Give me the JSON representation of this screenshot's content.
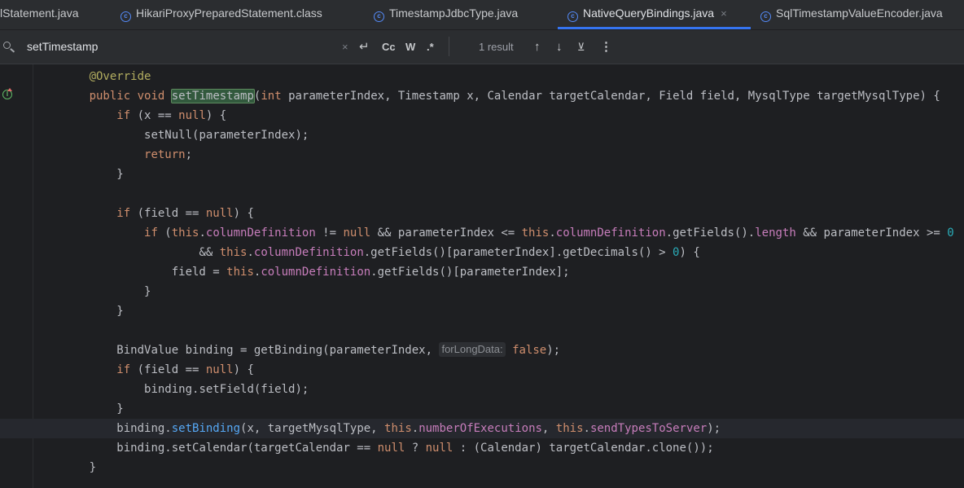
{
  "tabs": [
    {
      "label": "lStatement.java",
      "icon": "none",
      "active": false
    },
    {
      "label": "HikariProxyPreparedStatement.class",
      "icon": "class-icon",
      "active": false
    },
    {
      "label": "TimestampJdbcType.java",
      "icon": "class-icon",
      "active": false
    },
    {
      "label": "NativeQueryBindings.java",
      "icon": "class-icon",
      "active": true,
      "close": "×"
    },
    {
      "label": "SqlTimestampValueEncoder.java",
      "icon": "class-icon",
      "active": false
    }
  ],
  "search": {
    "query": "setTimestamp",
    "clear": "×",
    "newline": "↵",
    "match_case": "Cc",
    "words": "W",
    "regex": ".*",
    "result_count": "1 result",
    "prev": "↑",
    "next": "↓",
    "filter": "⊻",
    "more": "⋮"
  },
  "colors": {
    "background": "#1e1f22",
    "keyword": "#cf8e6d",
    "annotation": "#b3ae60",
    "field": "#c77dbb",
    "number": "#2aacb8",
    "active_tab_underline": "#3574f0",
    "search_highlight": "#32593d"
  },
  "code": {
    "inlay_hint": "forLongData:",
    "lines": [
      {
        "indent": "    ",
        "tokens": [
          [
            "ann",
            "@Override"
          ]
        ]
      },
      {
        "indent": "    ",
        "tokens": [
          [
            "kw",
            "public"
          ],
          [
            "",
            " "
          ],
          [
            "kw",
            "void"
          ],
          [
            "",
            " "
          ],
          [
            "hl",
            "setTimestamp"
          ],
          [
            "",
            "("
          ],
          [
            "kw",
            "int"
          ],
          [
            "",
            " parameterIndex, Timestamp x, Calendar targetCalendar, Field field, MysqlType targetMysqlType) {"
          ]
        ]
      },
      {
        "indent": "        ",
        "tokens": [
          [
            "kw",
            "if"
          ],
          [
            "",
            " (x == "
          ],
          [
            "kw",
            "null"
          ],
          [
            "",
            ") {"
          ]
        ]
      },
      {
        "indent": "            ",
        "tokens": [
          [
            "",
            "setNull(parameterIndex);"
          ]
        ]
      },
      {
        "indent": "            ",
        "tokens": [
          [
            "kw",
            "return"
          ],
          [
            "",
            ";"
          ]
        ]
      },
      {
        "indent": "        ",
        "tokens": [
          [
            "",
            "}"
          ]
        ]
      },
      {
        "indent": "",
        "tokens": []
      },
      {
        "indent": "        ",
        "tokens": [
          [
            "kw",
            "if"
          ],
          [
            "",
            " (field == "
          ],
          [
            "kw",
            "null"
          ],
          [
            "",
            ") {"
          ]
        ]
      },
      {
        "indent": "            ",
        "tokens": [
          [
            "kw",
            "if"
          ],
          [
            "",
            " ("
          ],
          [
            "kw",
            "this"
          ],
          [
            "",
            "."
          ],
          [
            "fld",
            "columnDefinition"
          ],
          [
            "",
            " != "
          ],
          [
            "kw",
            "null"
          ],
          [
            "",
            " && parameterIndex <= "
          ],
          [
            "kw",
            "this"
          ],
          [
            "",
            "."
          ],
          [
            "fld",
            "columnDefinition"
          ],
          [
            "",
            ".getFields()."
          ],
          [
            "fld",
            "length"
          ],
          [
            "",
            " && parameterIndex >= "
          ],
          [
            "num",
            "0"
          ]
        ]
      },
      {
        "indent": "                    ",
        "tokens": [
          [
            "",
            "&& "
          ],
          [
            "kw",
            "this"
          ],
          [
            "",
            "."
          ],
          [
            "fld",
            "columnDefinition"
          ],
          [
            "",
            ".getFields()[parameterIndex].getDecimals() > "
          ],
          [
            "num",
            "0"
          ],
          [
            "",
            ") {"
          ]
        ]
      },
      {
        "indent": "                ",
        "tokens": [
          [
            "",
            "field = "
          ],
          [
            "kw",
            "this"
          ],
          [
            "",
            "."
          ],
          [
            "fld",
            "columnDefinition"
          ],
          [
            "",
            ".getFields()[parameterIndex];"
          ]
        ]
      },
      {
        "indent": "            ",
        "tokens": [
          [
            "",
            "}"
          ]
        ]
      },
      {
        "indent": "        ",
        "tokens": [
          [
            "",
            "}"
          ]
        ]
      },
      {
        "indent": "",
        "tokens": []
      },
      {
        "indent": "        ",
        "tokens": [
          [
            "",
            "BindValue binding = getBinding(parameterIndex, "
          ],
          [
            "hint",
            "forLongData:"
          ],
          [
            "",
            " "
          ],
          [
            "kw",
            "false"
          ],
          [
            "",
            ");"
          ]
        ]
      },
      {
        "indent": "        ",
        "tokens": [
          [
            "kw",
            "if"
          ],
          [
            "",
            " (field == "
          ],
          [
            "kw",
            "null"
          ],
          [
            "",
            ") {"
          ]
        ]
      },
      {
        "indent": "            ",
        "tokens": [
          [
            "",
            "binding.setField(field);"
          ]
        ]
      },
      {
        "indent": "        ",
        "tokens": [
          [
            "",
            "}"
          ]
        ]
      },
      {
        "indent": "        ",
        "current": true,
        "tokens": [
          [
            "",
            "binding."
          ],
          [
            "mu",
            "setBinding"
          ],
          [
            "",
            "(x, targetMysqlType, "
          ],
          [
            "kw",
            "this"
          ],
          [
            "",
            "."
          ],
          [
            "fld",
            "numberOfExecutions"
          ],
          [
            "",
            ", "
          ],
          [
            "kw",
            "this"
          ],
          [
            "",
            "."
          ],
          [
            "fld",
            "sendTypesToServer"
          ],
          [
            "",
            ");"
          ]
        ]
      },
      {
        "indent": "        ",
        "tokens": [
          [
            "",
            "binding.setCalendar(targetCalendar == "
          ],
          [
            "kw",
            "null"
          ],
          [
            "",
            " ? "
          ],
          [
            "kw",
            "null"
          ],
          [
            "",
            " : (Calendar) targetCalendar.clone());"
          ]
        ]
      },
      {
        "indent": "    ",
        "tokens": [
          [
            "",
            "}"
          ]
        ]
      }
    ]
  }
}
